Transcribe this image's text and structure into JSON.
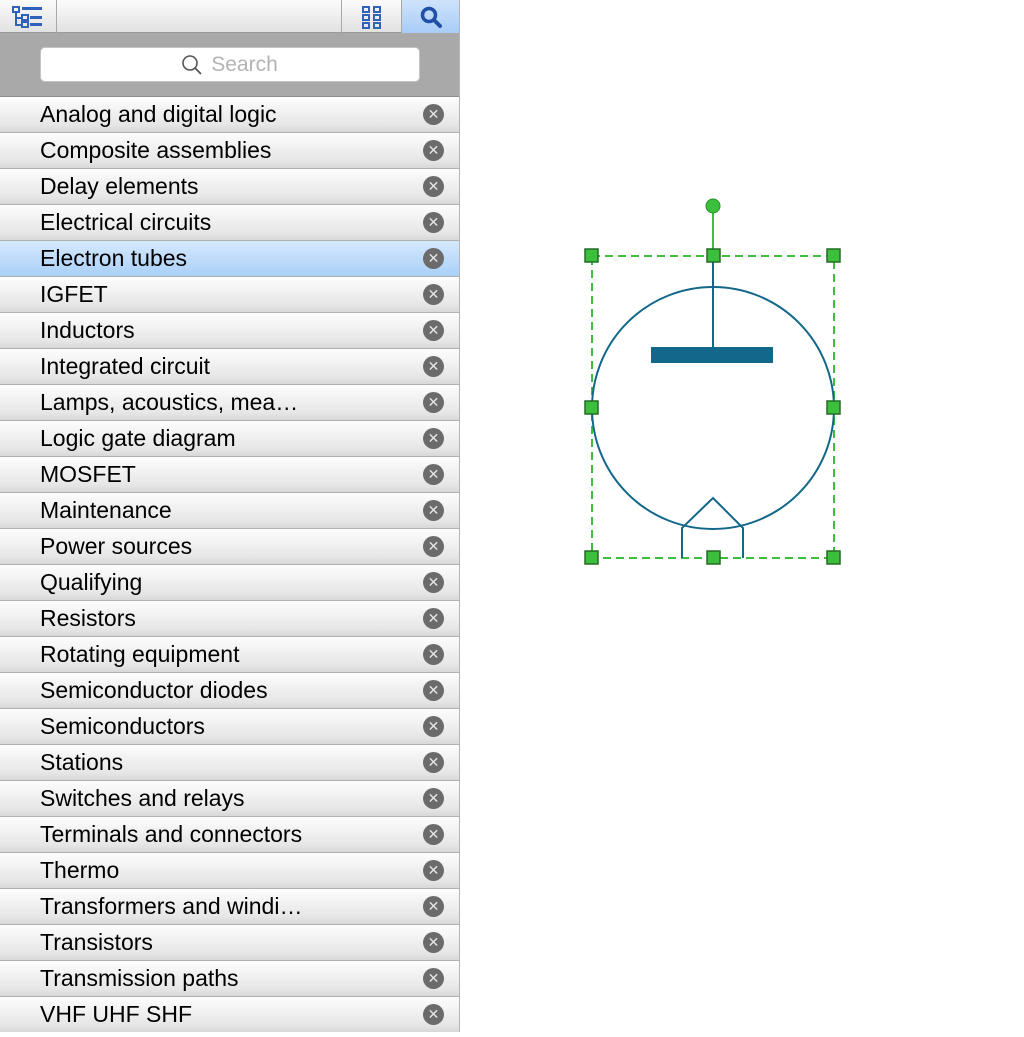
{
  "toolbar": {
    "tree_icon": "tree-view-icon",
    "grid_icon": "grid-view-icon",
    "search_icon": "search-icon"
  },
  "search": {
    "placeholder": "Search"
  },
  "libraries": [
    "Analog and digital logic",
    "Composite assemblies",
    "Delay elements",
    "Electrical circuits",
    "Electron tubes",
    "IGFET",
    "Inductors",
    "Integrated circuit",
    "Lamps, acoustics, mea…",
    "Logic gate diagram",
    "MOSFET",
    "Maintenance",
    "Power sources",
    "Qualifying",
    "Resistors",
    "Rotating equipment",
    "Semiconductor diodes",
    "Semiconductors",
    "Stations",
    "Switches and relays",
    "Terminals and connectors",
    "Thermo",
    "Transformers and windi…",
    "Transistors",
    "Transmission paths",
    "VHF UHF SHF"
  ],
  "selected_index": 4,
  "colors": {
    "shape": "#12678a",
    "selection": "#3cbf3c",
    "toolbar_active": "#a7cdf7"
  }
}
